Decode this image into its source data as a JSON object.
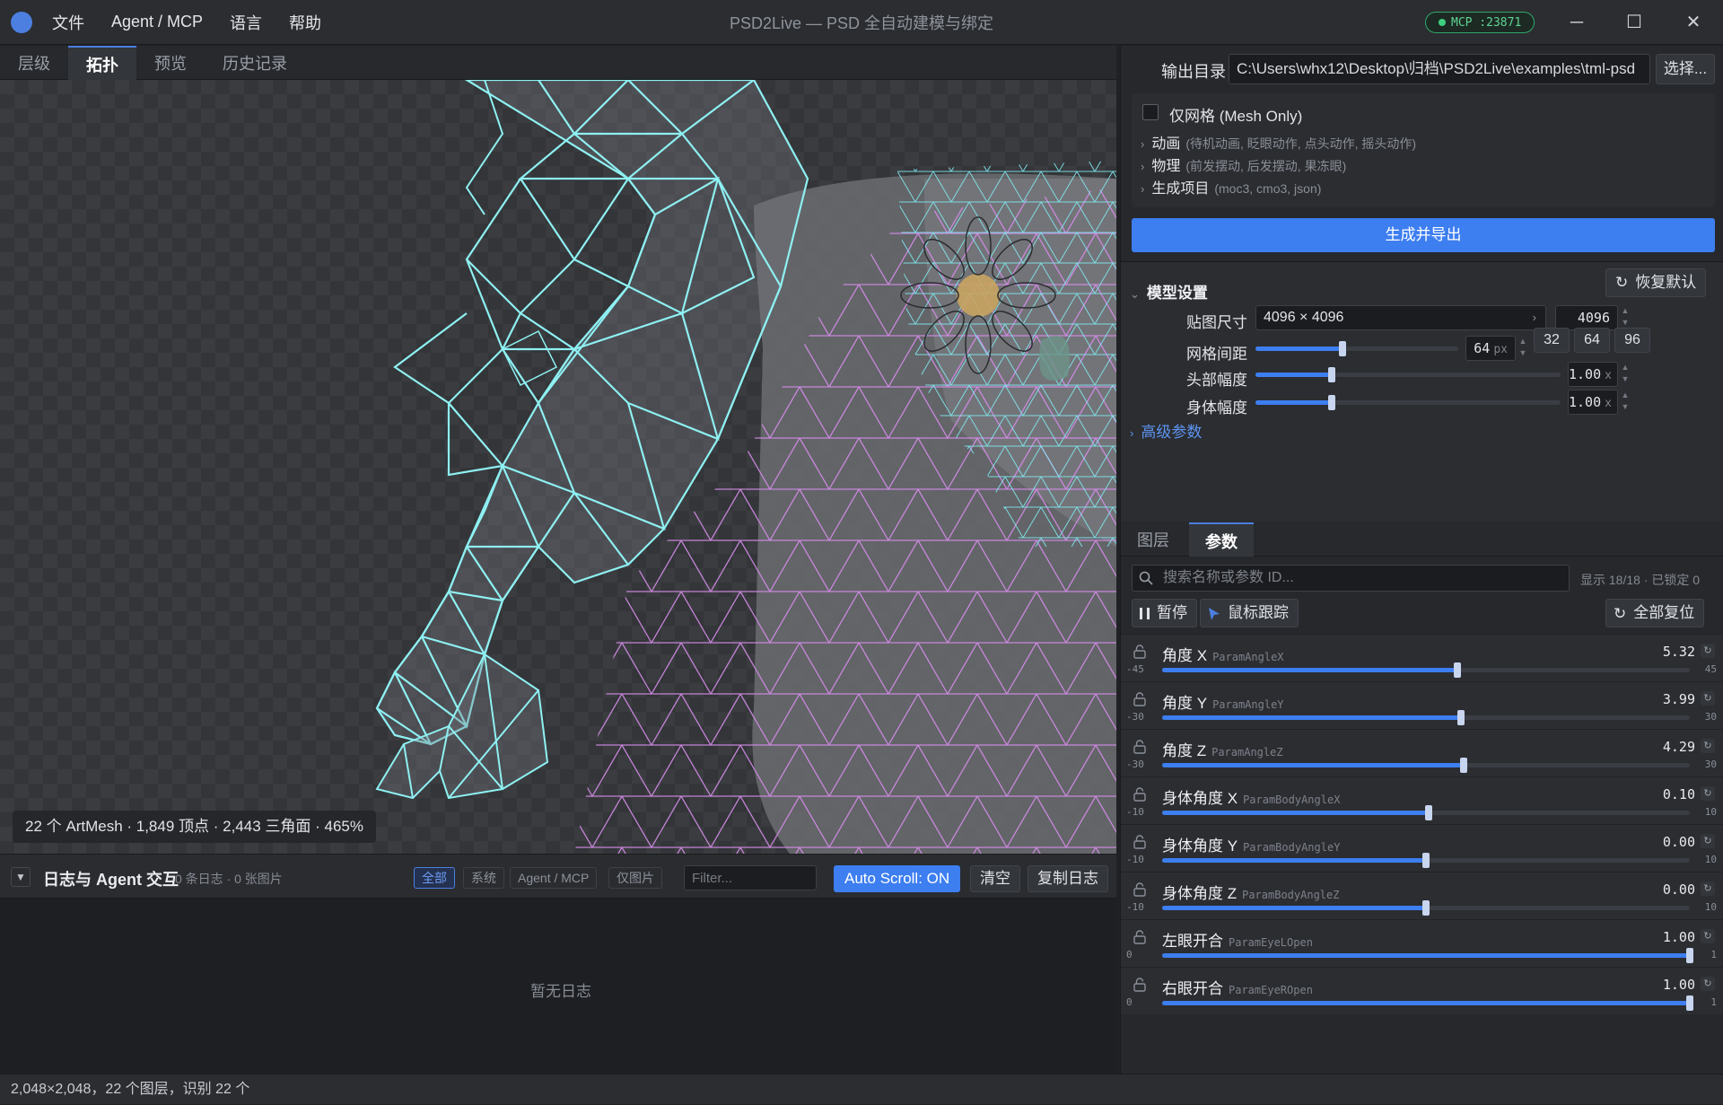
{
  "titlebar": {
    "menu": [
      "文件",
      "Agent / MCP",
      "语言",
      "帮助"
    ],
    "title": "PSD2Live — PSD 全自动建模与绑定",
    "mcp_badge": "MCP :23871"
  },
  "left_tabs": [
    {
      "label": "层级",
      "active": false
    },
    {
      "label": "拓扑",
      "active": true
    },
    {
      "label": "预览",
      "active": false
    },
    {
      "label": "历史记录",
      "active": false
    }
  ],
  "canvas": {
    "stats": "22 个 ArtMesh · 1,849 顶点 · 2,443 三角面 · 465%"
  },
  "log": {
    "title": "日志与 Agent 交互",
    "count": "0 条日志 · 0 张图片",
    "filters": [
      "全部",
      "系统",
      "Agent / MCP",
      "仅图片"
    ],
    "filter_placeholder": "Filter...",
    "autoscroll": "Auto Scroll: ON",
    "clear": "清空",
    "copy": "复制日志",
    "empty": "暂无日志"
  },
  "statusbar": "2,048×2,048，22 个图层，识别 22 个",
  "right": {
    "outdir_label": "输出目录",
    "outdir_value": "C:\\Users\\whx12\\Desktop\\归档\\PSD2Live\\examples\\tml-psd",
    "outdir_button": "选择...",
    "mesh_only": "仅网格 (Mesh Only)",
    "expanders": [
      {
        "label": "动画",
        "sub": "(待机动画, 眨眼动作, 点头动作, 摇头动作)"
      },
      {
        "label": "物理",
        "sub": "(前发摆动, 后发摆动, 果冻眼)"
      },
      {
        "label": "生成项目",
        "sub": "(moc3, cmo3, json)"
      }
    ],
    "generate": "生成并导出",
    "model_settings": {
      "title": "模型设置",
      "reset": "恢复默认",
      "texture_label": "贴图尺寸",
      "texture_value": "4096 × 4096",
      "texture_spin": "4096",
      "grid_label": "网格间距",
      "grid_value": "64",
      "grid_unit": "px",
      "grid_fraction": 0.43,
      "grid_presets": [
        "32",
        "64",
        "96"
      ],
      "head_label": "头部幅度",
      "head_value": "1.00",
      "head_fraction": 0.25,
      "body_label": "身体幅度",
      "body_value": "1.00",
      "body_fraction": 0.25,
      "unit_x": "x",
      "advanced": "高级参数"
    },
    "tabs": [
      {
        "label": "图层",
        "active": false
      },
      {
        "label": "参数",
        "active": true
      }
    ],
    "search_placeholder": "搜索名称或参数 ID...",
    "shown": "显示 18/18 · 已锁定 0",
    "pause": "暂停",
    "mouse_track": "鼠标跟踪",
    "reset_all": "全部复位",
    "params": [
      {
        "name": "角度 X",
        "id": "ParamAngleX",
        "value": "5.32",
        "min": "-45",
        "max": "45",
        "v": 5.32,
        "lo": -45,
        "hi": 45
      },
      {
        "name": "角度 Y",
        "id": "ParamAngleY",
        "value": "3.99",
        "min": "-30",
        "max": "30",
        "v": 3.99,
        "lo": -30,
        "hi": 30
      },
      {
        "name": "角度 Z",
        "id": "ParamAngleZ",
        "value": "4.29",
        "min": "-30",
        "max": "30",
        "v": 4.29,
        "lo": -30,
        "hi": 30
      },
      {
        "name": "身体角度 X",
        "id": "ParamBodyAngleX",
        "value": "0.10",
        "min": "-10",
        "max": "10",
        "v": 0.1,
        "lo": -10,
        "hi": 10
      },
      {
        "name": "身体角度 Y",
        "id": "ParamBodyAngleY",
        "value": "0.00",
        "min": "-10",
        "max": "10",
        "v": 0,
        "lo": -10,
        "hi": 10
      },
      {
        "name": "身体角度 Z",
        "id": "ParamBodyAngleZ",
        "value": "0.00",
        "min": "-10",
        "max": "10",
        "v": 0,
        "lo": -10,
        "hi": 10
      },
      {
        "name": "左眼开合",
        "id": "ParamEyeLOpen",
        "value": "1.00",
        "min": "0",
        "max": "1",
        "v": 1,
        "lo": 0,
        "hi": 1
      },
      {
        "name": "右眼开合",
        "id": "ParamEyeROpen",
        "value": "1.00",
        "min": "0",
        "max": "1",
        "v": 1,
        "lo": 0,
        "hi": 1
      }
    ]
  }
}
